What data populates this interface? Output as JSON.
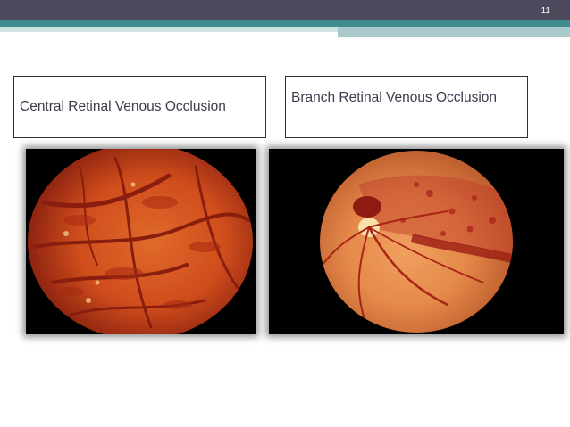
{
  "slide": {
    "page_number": "11"
  },
  "captions": {
    "left": "Central Retinal Venous Occlusion",
    "right": "Branch Retinal Venous Occlusion"
  },
  "images": {
    "left_icon": "fundus-photo-crvo-icon",
    "right_icon": "fundus-photo-brvo-icon"
  },
  "colors": {
    "header_bar": "#4a4a5c",
    "accent_teal": "#3f8c8f",
    "accent_light": "#cfe1e1",
    "caption_text": "#3b3b4d"
  }
}
